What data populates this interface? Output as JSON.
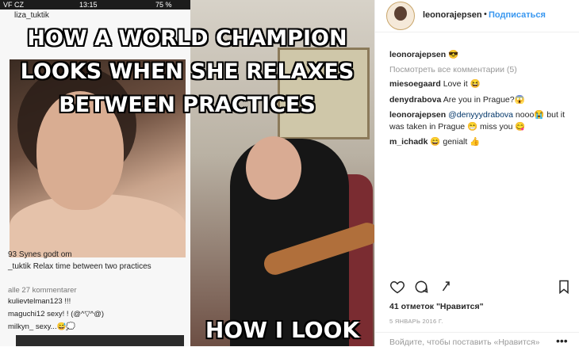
{
  "post_image": {
    "meme_top_text": "HOW A WORLD CHAMPION LOOKS WHEN SHE RELAXES BETWEEN PRACTICES",
    "meme_bottom_text": "HOW I LOOK",
    "phone_status": {
      "carrier": "VF CZ",
      "time": "13:15",
      "battery": "75 %"
    },
    "inner_post": {
      "username": "liza_tuktik",
      "likes_line": "93 Synes godt om",
      "caption_user": "_tuktik",
      "caption_text": "Relax time between two practices",
      "comments_link": "alle 27 kommentarer",
      "comments": [
        "kulievtelman123 !!!",
        "maguchi12 sexy!  ! (@^▽^@)",
        "milkyn_ sexy...😅💭"
      ]
    }
  },
  "header": {
    "username": "leonorajepsen",
    "separator": "•",
    "follow_label": "Подписаться"
  },
  "caption": {
    "username": "leonorajepsen",
    "emoji": "😎"
  },
  "view_all_comments": "Посмотреть все комментарии (5)",
  "comments": [
    {
      "user": "miesoegaard",
      "text": "Love it 😆"
    },
    {
      "user": "denydrabova",
      "text": "Are you in Prague?😱"
    },
    {
      "user": "leonorajepsen",
      "mention": "@denyyydrabova",
      "text": "nooo😭 but it was taken in Prague 😁 miss you 😋"
    },
    {
      "user": "m_ichadk",
      "text": "😄 genialt 👍"
    }
  ],
  "actions": {
    "like_icon": "heart-icon",
    "comment_icon": "comment-bubble-icon",
    "share_icon": "share-icon",
    "save_icon": "bookmark-icon"
  },
  "likes": "41 отметок \"Нравится\"",
  "date": "5 ЯНВАРЬ 2016 Г.",
  "login_prompt": "Войдите, чтобы поставить «Нравится»",
  "more_icon": "more-dots-icon"
}
